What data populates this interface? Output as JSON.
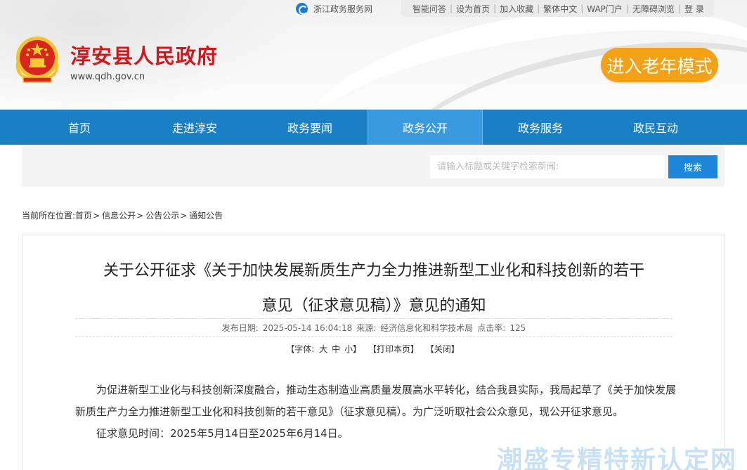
{
  "topbar": {
    "zj_link": "浙江政务服务网",
    "links": [
      "智能问答",
      "设为首页",
      "加入收藏",
      "繁体中文",
      "WAP门户",
      "无障碍浏览",
      "登 录"
    ]
  },
  "header": {
    "site_title": "淳安县人民政府",
    "site_url": "www.qdh.gov.cn",
    "elder_mode": "进入老年模式"
  },
  "nav": {
    "items": [
      "首页",
      "走进淳安",
      "政务要闻",
      "政务公开",
      "政务服务",
      "政民互动"
    ],
    "active": "政务公开"
  },
  "search": {
    "placeholder": "请输入标题或关键字检索新闻:",
    "button": "搜索"
  },
  "breadcrumb": {
    "label": "当前所在位置:",
    "items": [
      "首页",
      "信息公开",
      "公告公示",
      "通知公告"
    ]
  },
  "article": {
    "title_line1": "关于公开征求《关于加快发展新质生产力全力推进新型工业化和科技创新的若干",
    "title_line2": "意见（征求意见稿）》意见的通知",
    "meta": {
      "date_label": "发布日期:",
      "date": "2025-05-14 16:04:18",
      "source_label": "来源:",
      "source": "经济信息化和科学技术局",
      "clicks_label": "点击率:",
      "clicks": "125"
    },
    "tools": {
      "font_label": "【字体:",
      "font_large": "大",
      "font_medium": "中",
      "font_small": "小】",
      "print": "【打印本页】",
      "close": "【关闭】"
    },
    "paragraph1": "为促进新型工业化与科技创新深度融合，推动生态制造业高质量发展高水平转化，结合我县实际，我局起草了《关于加快发展新质生产力全力推进新型工业化和科技创新的若干意见》（征求意见稿）。为广泛听取社会公众意见，现公开征求意见。",
    "paragraph2": "征求意见时间：2025年5月14日至2025年6月14日。"
  },
  "watermark": "潮盛专精特新认定网",
  "colors": {
    "nav_bg": "#1a7fc4",
    "nav_active": "#3a9ae0",
    "title_red": "#d0181c",
    "elder_orange": "#f3a117",
    "search_btn": "#1d86d8"
  }
}
